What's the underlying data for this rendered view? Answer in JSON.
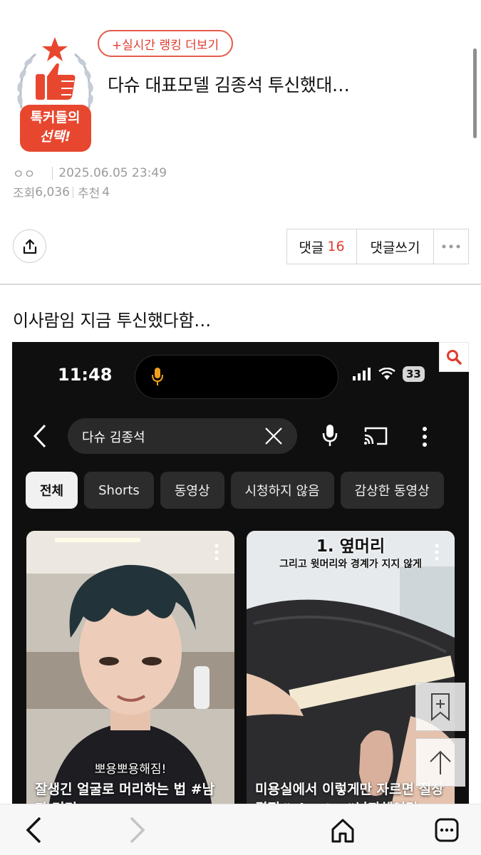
{
  "badge": {
    "line1": "톡커들의",
    "line2": "선택!",
    "star_color": "#e8472f",
    "badge_color": "#e8472f"
  },
  "header": {
    "ranking_button": "+실시간 랭킹 더보기",
    "title": "다슈 대표모델 김종석 투신했대…",
    "author": "ㅇㅇ",
    "datetime": "2025.06.05 23:49",
    "views_label": "조회",
    "views": "6,036",
    "recommend_label": "추천",
    "recommend": "4"
  },
  "actions": {
    "comment_label": "댓글",
    "comment_count": "16",
    "write_label": "댓글쓰기"
  },
  "body": {
    "text": "이사람임 지금 투신했다함…"
  },
  "embedded_screenshot": {
    "time": "11:48",
    "battery": "33",
    "search_query": "다슈 김종석",
    "chips": [
      {
        "label": "전체",
        "active": true
      },
      {
        "label": "Shorts",
        "active": false
      },
      {
        "label": "동영상",
        "active": false
      },
      {
        "label": "시청하지 않음",
        "active": false
      },
      {
        "label": "감상한 동영상",
        "active": false
      }
    ],
    "videos": [
      {
        "overlay_caption": "뽀용뽀용해짐!",
        "title": "잘생긴 얼굴로 머리하는 법 #남자 머리"
      },
      {
        "heading": "1. 옆머리",
        "subheading": "그리고 윗머리와 경계가 지지 않게",
        "title": "미용실에서 이렇게만 자르면 절상 결정#shorts #남자헤어컷"
      }
    ]
  },
  "colors": {
    "accent": "#e03b2e",
    "meta_text": "#9b9b9b",
    "yt_bg": "#0f0f0f"
  }
}
